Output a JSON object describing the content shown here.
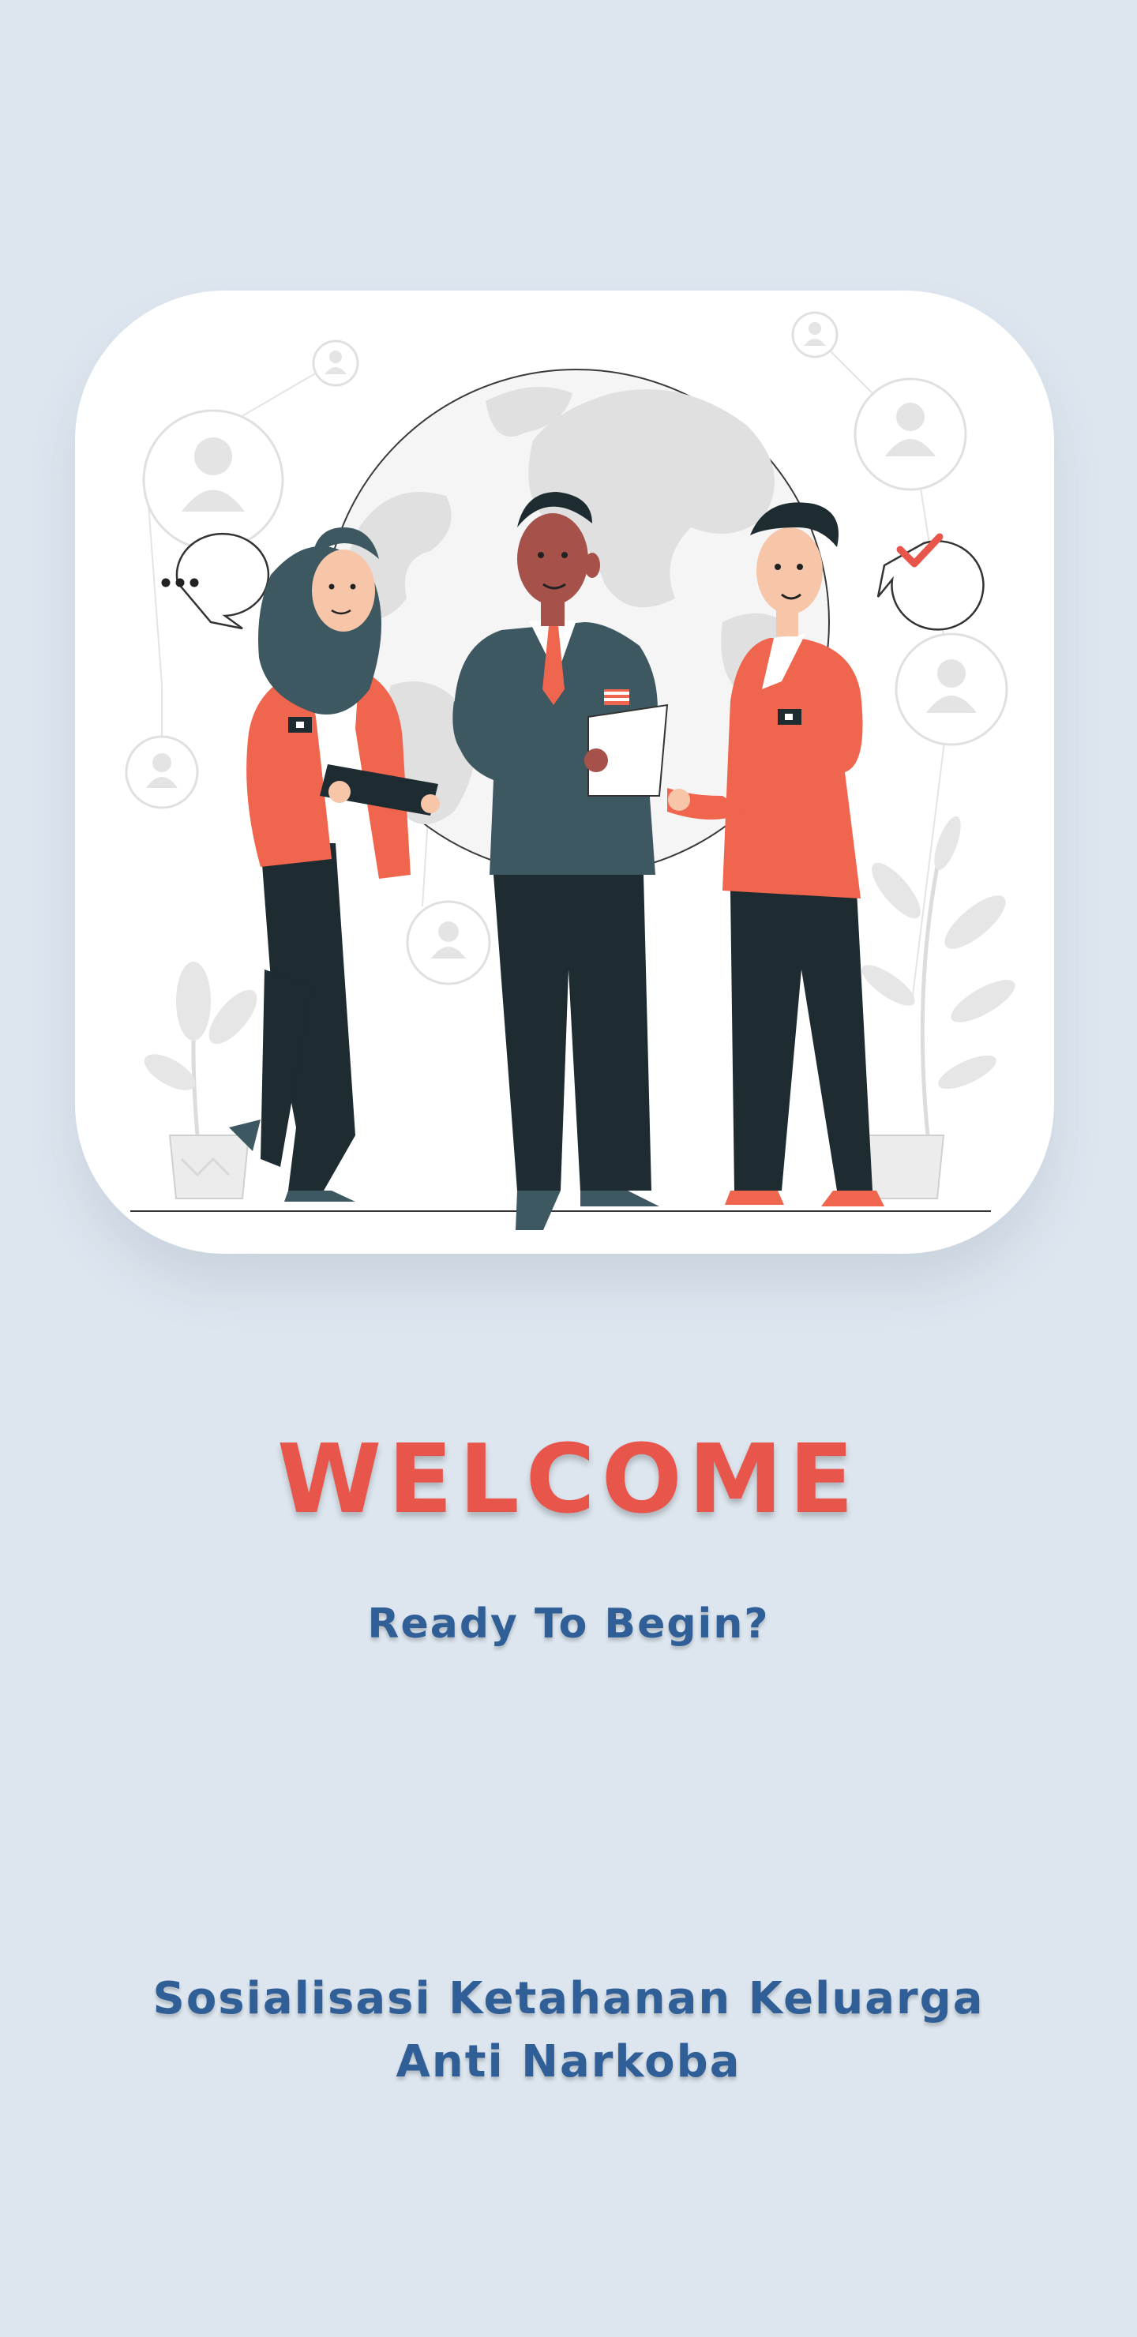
{
  "hero": {
    "illustration": "team-meeting-illustration",
    "icons": [
      "chat-ellipsis-icon",
      "checkmark-chat-icon",
      "user-profile-icon",
      "globe-icon",
      "plant-icon"
    ]
  },
  "welcome": {
    "title": "WELCOME",
    "subtitle": "Ready To Begin?"
  },
  "footer": {
    "line1": "Sosialisasi Ketahanan Keluarga",
    "line2": "Anti Narkoba"
  },
  "colors": {
    "background": "#dde6ef",
    "accent": "#e8554a",
    "text_blue": "#2f5f96",
    "jacket": "#f0654d",
    "suit": "#3d5861",
    "trousers": "#1e2b30"
  }
}
